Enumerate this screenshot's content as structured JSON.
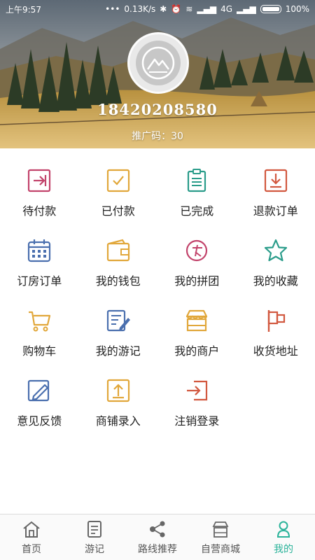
{
  "statusbar": {
    "time": "上午9:57",
    "network": "0.13K/s",
    "signal": "4G",
    "battery": "100%"
  },
  "profile": {
    "phone": "18420208580",
    "promo_code": "推广码：30"
  },
  "menu": [
    {
      "label": "待付款",
      "icon": "arrow-into-box-icon",
      "color": "#c2436b"
    },
    {
      "label": "已付款",
      "icon": "checkbox-icon",
      "color": "#e1a73a"
    },
    {
      "label": "已完成",
      "icon": "clipboard-icon",
      "color": "#2a9c8a"
    },
    {
      "label": "退款订单",
      "icon": "download-box-icon",
      "color": "#d2583f"
    },
    {
      "label": "订房订单",
      "icon": "calendar-icon",
      "color": "#4a6fae"
    },
    {
      "label": "我的钱包",
      "icon": "wallet-icon",
      "color": "#e1a73a"
    },
    {
      "label": "我的拼团",
      "icon": "group-buy-icon",
      "color": "#c2436b"
    },
    {
      "label": "我的收藏",
      "icon": "star-icon",
      "color": "#2a9c8a"
    },
    {
      "label": "购物车",
      "icon": "cart-icon",
      "color": "#e1a73a"
    },
    {
      "label": "我的游记",
      "icon": "note-edit-icon",
      "color": "#4a6fae"
    },
    {
      "label": "我的商户",
      "icon": "shop-icon",
      "color": "#e1a73a"
    },
    {
      "label": "收货地址",
      "icon": "flag-icon",
      "color": "#d2583f"
    },
    {
      "label": "意见反馈",
      "icon": "pencil-box-icon",
      "color": "#4a6fae"
    },
    {
      "label": "商铺录入",
      "icon": "upload-box-icon",
      "color": "#e1a73a"
    },
    {
      "label": "注销登录",
      "icon": "logout-icon",
      "color": "#d2583f"
    }
  ],
  "tabs": [
    {
      "label": "首页",
      "icon": "home-icon"
    },
    {
      "label": "游记",
      "icon": "document-icon"
    },
    {
      "label": "路线推荐",
      "icon": "route-share-icon"
    },
    {
      "label": "自营商城",
      "icon": "store-icon"
    },
    {
      "label": "我的",
      "icon": "user-icon",
      "active": true
    }
  ],
  "colors": {
    "accent": "#2bb39a"
  }
}
